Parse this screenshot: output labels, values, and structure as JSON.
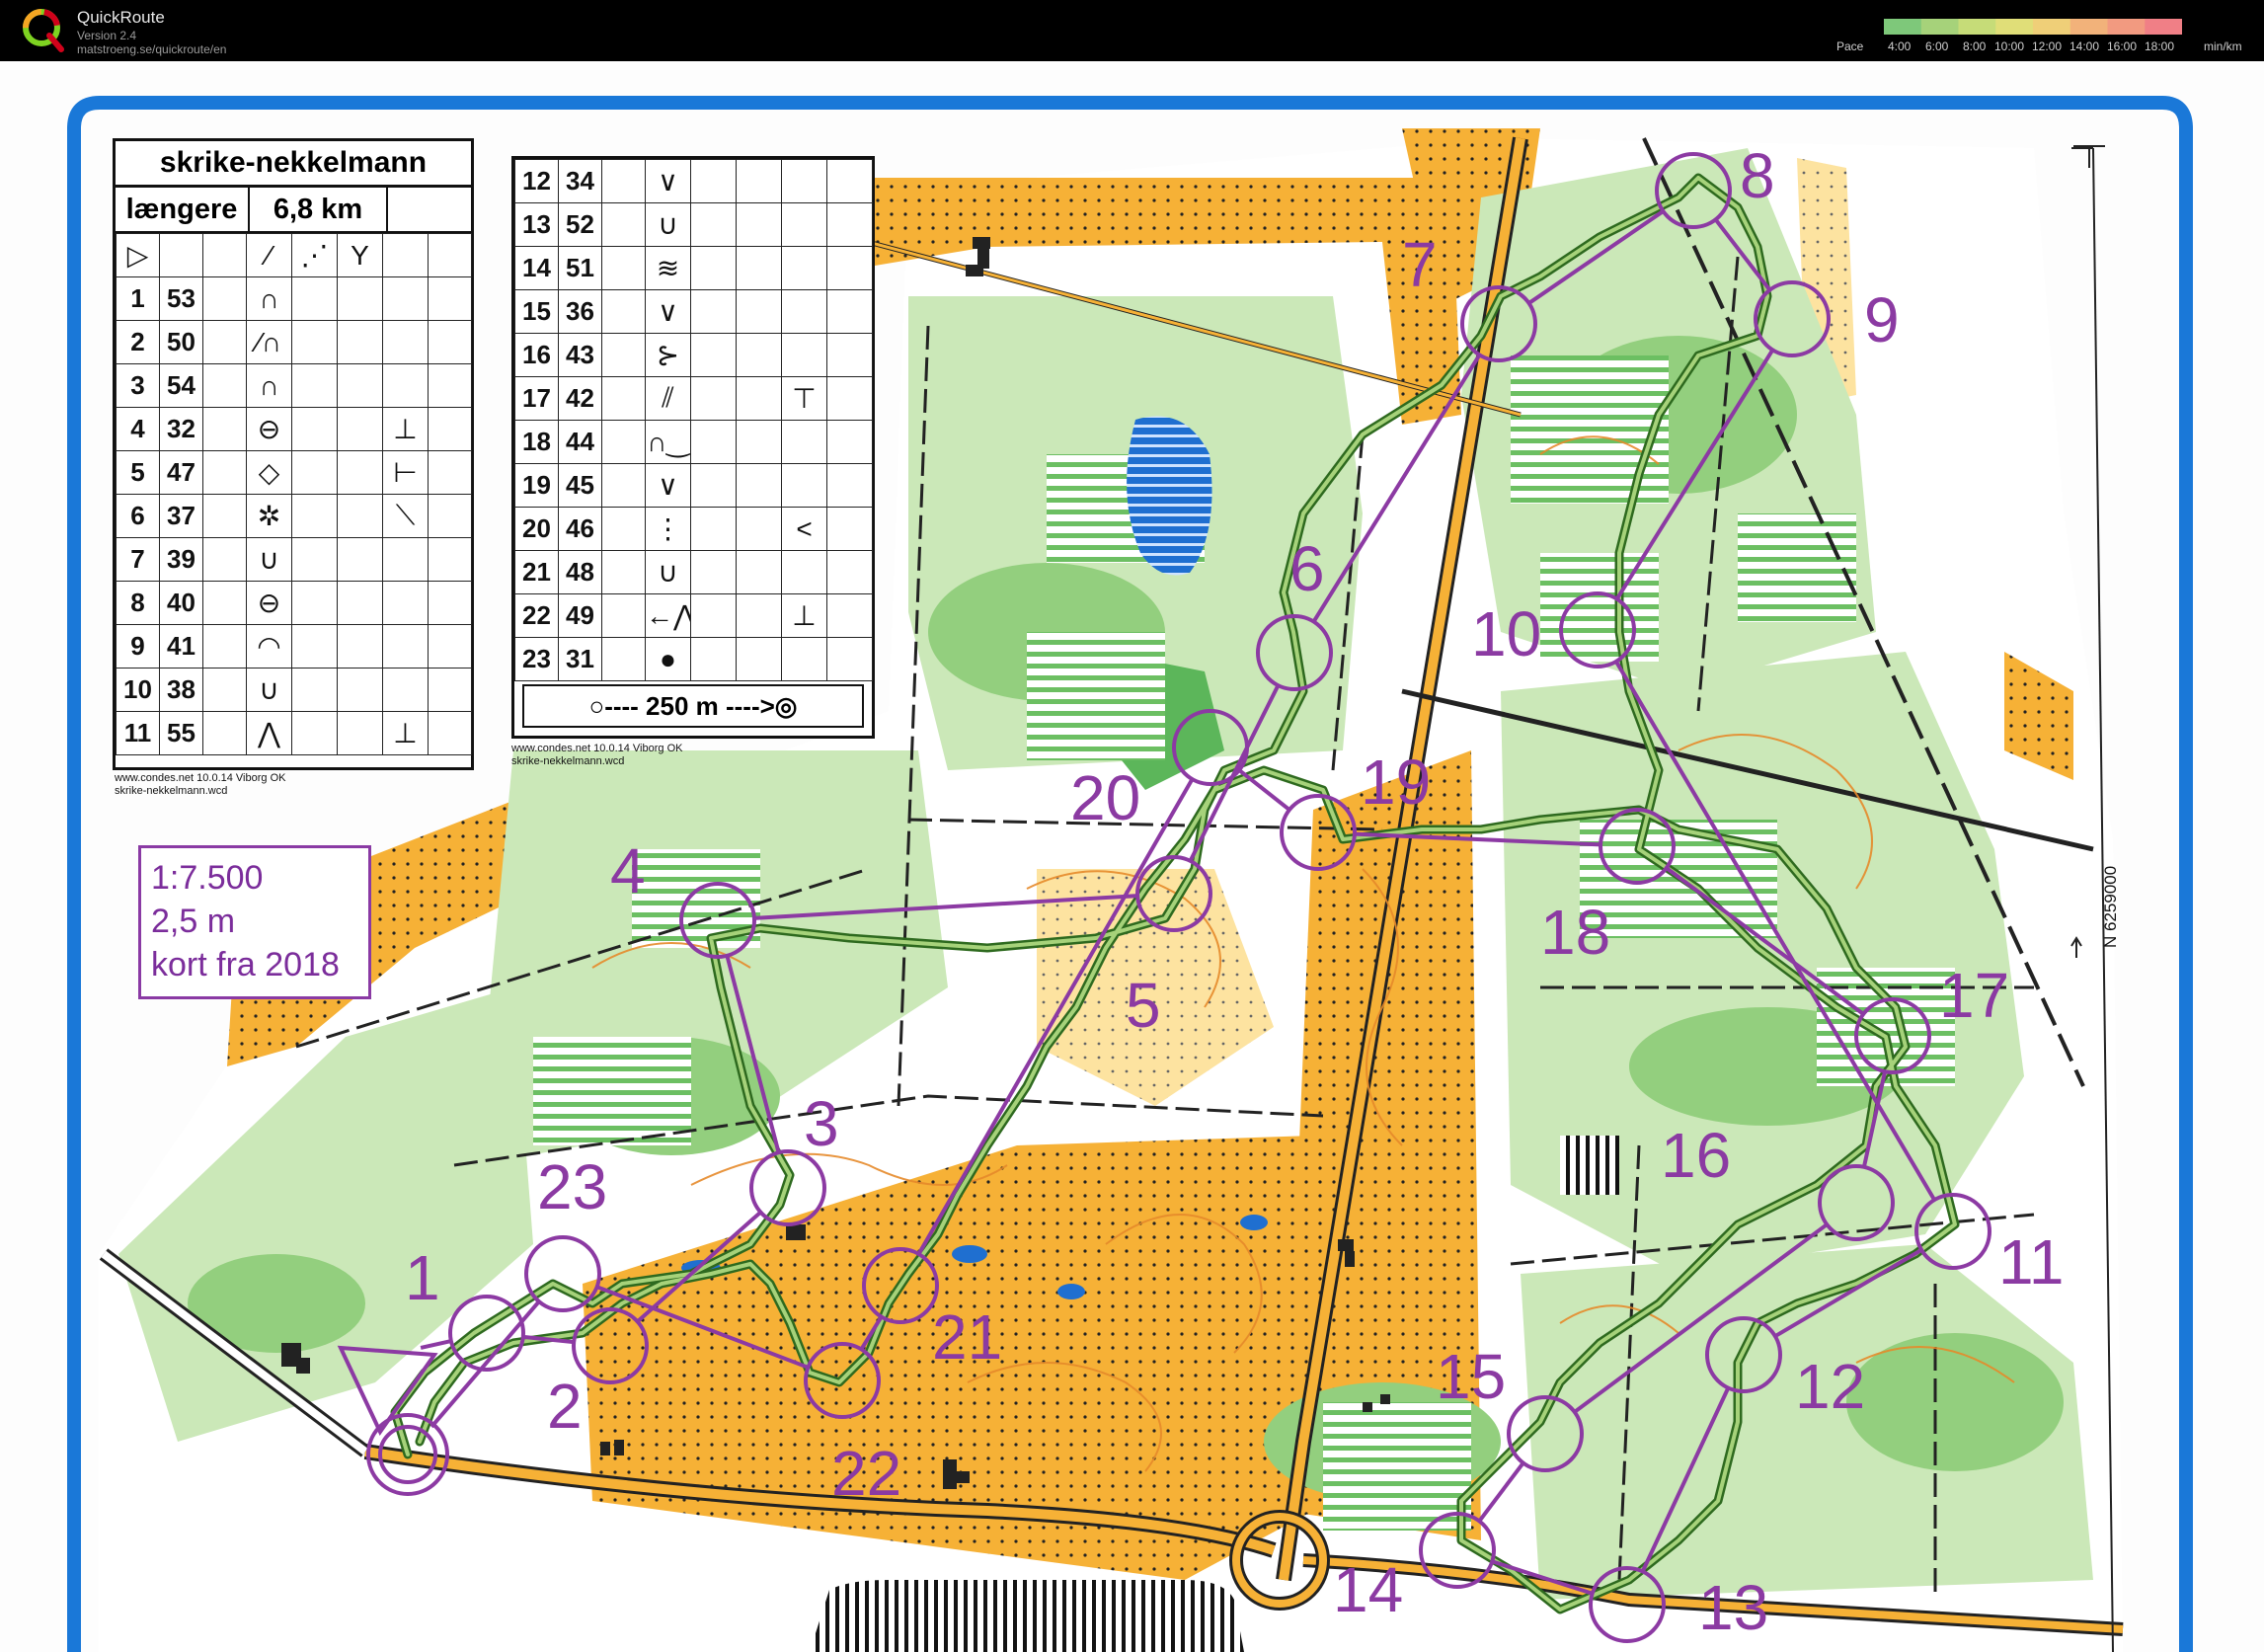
{
  "app": {
    "title": "QuickRoute",
    "version": "Version 2.4",
    "url": "matstroeng.se/quickroute/en"
  },
  "pace": {
    "label": "Pace",
    "ticks": [
      "4:00",
      "6:00",
      "8:00",
      "10:00",
      "12:00",
      "14:00",
      "16:00",
      "18:00"
    ],
    "unit": "min/km",
    "colors": [
      "#7ec87a",
      "#a6d27a",
      "#c6dc78",
      "#e0de78",
      "#efcf78",
      "#f2b27a",
      "#f29a80",
      "#f07f86"
    ]
  },
  "map": {
    "colors": {
      "forest": "#ffffff",
      "green_light": "#cbe8b8",
      "green_mid": "#93cf7e",
      "green_dark": "#5cb65a",
      "open": "#f6b136",
      "open_rough": "#fde6a0",
      "course": "#8c3aa3",
      "route": "#3d8f2e",
      "water": "#1f6fd0"
    }
  },
  "desc_left": {
    "title": "skrike-nekkelmann",
    "class": "længere",
    "length": "6,8 km",
    "rows": [
      {
        "n": "1",
        "code": "53",
        "sym": "∩",
        "extra": "",
        "dir": ""
      },
      {
        "n": "2",
        "code": "50",
        "sym": "⁄∩",
        "extra": "",
        "dir": ""
      },
      {
        "n": "3",
        "code": "54",
        "sym": "∩",
        "extra": "",
        "dir": ""
      },
      {
        "n": "4",
        "code": "32",
        "sym": "⊖",
        "extra": "",
        "dir": "⊥"
      },
      {
        "n": "5",
        "code": "47",
        "sym": "◇",
        "extra": "",
        "dir": "⊢"
      },
      {
        "n": "6",
        "code": "37",
        "sym": "✲",
        "extra": "",
        "dir": "⟍"
      },
      {
        "n": "7",
        "code": "39",
        "sym": "∪",
        "extra": "",
        "dir": ""
      },
      {
        "n": "8",
        "code": "40",
        "sym": "⊖",
        "extra": "",
        "dir": ""
      },
      {
        "n": "9",
        "code": "41",
        "sym": "◠",
        "extra": "",
        "dir": ""
      },
      {
        "n": "10",
        "code": "38",
        "sym": "∪",
        "extra": "",
        "dir": ""
      },
      {
        "n": "11",
        "code": "55",
        "sym": "⋀",
        "extra": "",
        "dir": "⊥"
      }
    ],
    "note1": "www.condes.net 10.0.14 Viborg OK",
    "note2": "skrike-nekkelmann.wcd"
  },
  "desc_right": {
    "rows": [
      {
        "n": "12",
        "code": "34",
        "sym": "∨",
        "dir": ""
      },
      {
        "n": "13",
        "code": "52",
        "sym": "∪",
        "dir": ""
      },
      {
        "n": "14",
        "code": "51",
        "sym": "≋",
        "dir": ""
      },
      {
        "n": "15",
        "code": "36",
        "sym": "∨",
        "dir": ""
      },
      {
        "n": "16",
        "code": "43",
        "sym": "⊱",
        "dir": ""
      },
      {
        "n": "17",
        "code": "42",
        "sym": "⫽",
        "dir": "⊤"
      },
      {
        "n": "18",
        "code": "44",
        "sym": "∩‿",
        "dir": ""
      },
      {
        "n": "19",
        "code": "45",
        "sym": "∨",
        "dir": ""
      },
      {
        "n": "20",
        "code": "46",
        "sym": "⋮",
        "dir": "<"
      },
      {
        "n": "21",
        "code": "48",
        "sym": "∪",
        "dir": ""
      },
      {
        "n": "22",
        "code": "49",
        "sym": "←⋀",
        "dir": "⊥"
      },
      {
        "n": "23",
        "code": "31",
        "sym": "●",
        "dir": ""
      }
    ],
    "footer": "○---- 250 m ---->◎",
    "note1": "www.condes.net 10.0.14 Viborg OK",
    "note2": "skrike-nekkelmann.wcd"
  },
  "scale": {
    "line1": "1:7.500",
    "line2": "2,5 m",
    "line3": "kort fra 2018"
  },
  "coord": "N 6259000",
  "controls": [
    "1",
    "2",
    "3",
    "4",
    "5",
    "6",
    "7",
    "8",
    "9",
    "10",
    "11",
    "12",
    "13",
    "14",
    "15",
    "16",
    "17",
    "18",
    "19",
    "20",
    "21",
    "22",
    "23"
  ]
}
